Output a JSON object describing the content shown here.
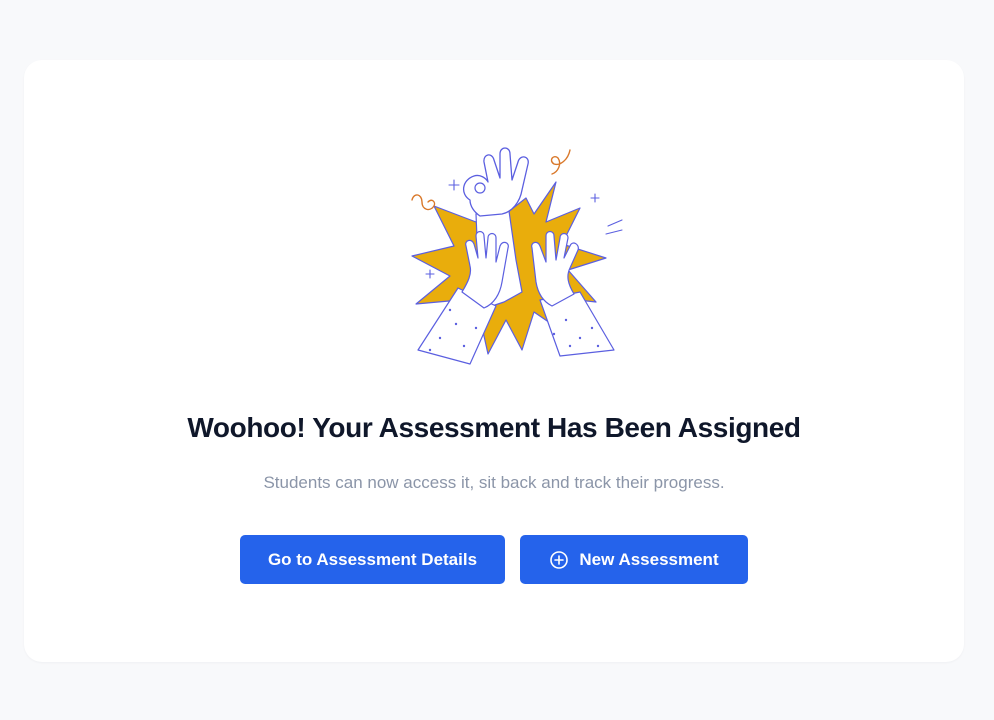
{
  "success": {
    "title": "Woohoo! Your Assessment Has Been Assigned",
    "subtitle": "Students can now access it, sit back and track their progress."
  },
  "actions": {
    "details_label": "Go to Assessment Details",
    "new_label": "New Assessment",
    "new_icon": "plus-circle-icon"
  },
  "colors": {
    "page_background": "#f8f9fb",
    "card_background": "#ffffff",
    "primary": "#2563eb",
    "title": "#0f172a",
    "subtitle": "#8b95a8",
    "illustration_burst": "#e9ad0c",
    "illustration_line": "#5b5fe0",
    "illustration_accent": "#d9782a"
  }
}
